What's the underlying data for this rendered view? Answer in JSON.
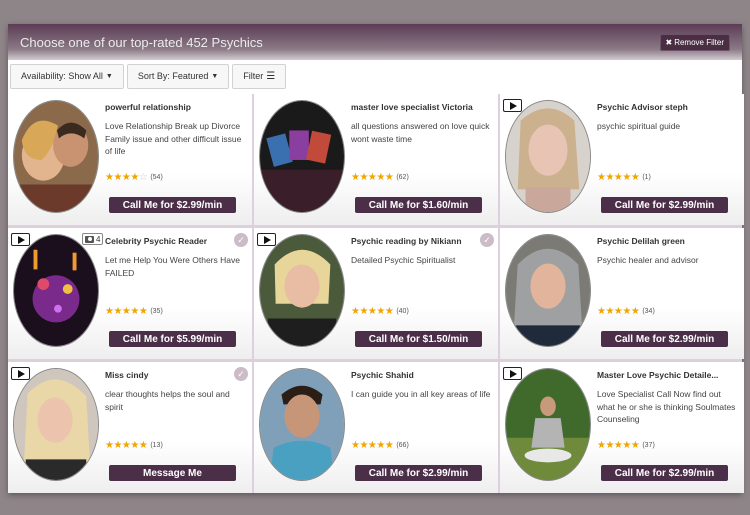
{
  "header": {
    "title": "Choose one of our top-rated 452 Psychics",
    "remove_filter": "Remove Filter",
    "remove_icon": "close-icon"
  },
  "toolbar": {
    "availability": "Availability: Show All",
    "sort": "Sort By: Featured",
    "filter": "Filter"
  },
  "colors": {
    "accent": "#4b2e48",
    "star": "#f0a500",
    "divider": "#ddd0db"
  },
  "cards": [
    {
      "name": "powerful relationship",
      "desc": "Love Relationship Break up Divorce Family issue and other difficult issue of life",
      "stars": 4,
      "count": "(54)",
      "button": "Call Me for $2.99/min",
      "play": false,
      "cam": "",
      "check": false
    },
    {
      "name": "master love specialist Victoria",
      "desc": "all questions answered on love quick wont waste time",
      "stars": 5,
      "count": "(62)",
      "button": "Call Me for $1.60/min",
      "play": false,
      "cam": "",
      "check": false
    },
    {
      "name": "Psychic Advisor steph",
      "desc": "psychic spiritual guide",
      "stars": 5,
      "count": "(1)",
      "button": "Call Me for $2.99/min",
      "play": true,
      "cam": "",
      "check": false
    },
    {
      "name": "Celebrity Psychic Reader",
      "desc": "Let me Help You Were Others Have FAILED",
      "stars": 5,
      "count": "(35)",
      "button": "Call Me for $5.99/min",
      "play": true,
      "cam": "4",
      "check": true
    },
    {
      "name": "Psychic reading by Nikiann",
      "desc": "Detailed Psychic Spiritualist",
      "stars": 5,
      "count": "(40)",
      "button": "Call Me for $1.50/min",
      "play": true,
      "cam": "",
      "check": true
    },
    {
      "name": "Psychic Delilah green",
      "desc": "Psychic healer and advisor",
      "stars": 5,
      "count": "(34)",
      "button": "Call Me for $2.99/min",
      "play": false,
      "cam": "",
      "check": false
    },
    {
      "name": "Miss cindy",
      "desc": "clear thoughts helps the soul and spirit",
      "stars": 5,
      "count": "(13)",
      "button": "Message Me",
      "play": true,
      "cam": "",
      "check": true
    },
    {
      "name": "Psychic Shahid",
      "desc": "I can guide you in all key areas of life",
      "stars": 5,
      "count": "(66)",
      "button": "Call Me for $2.99/min",
      "play": false,
      "cam": "",
      "check": false
    },
    {
      "name": "Master Love Psychic Detaile...",
      "desc": "Love Specialist Call Now find out what he or she is thinking Soulmates Counseling",
      "stars": 5,
      "count": "(37)",
      "button": "Call Me for $2.99/min",
      "play": true,
      "cam": "",
      "check": false
    }
  ]
}
